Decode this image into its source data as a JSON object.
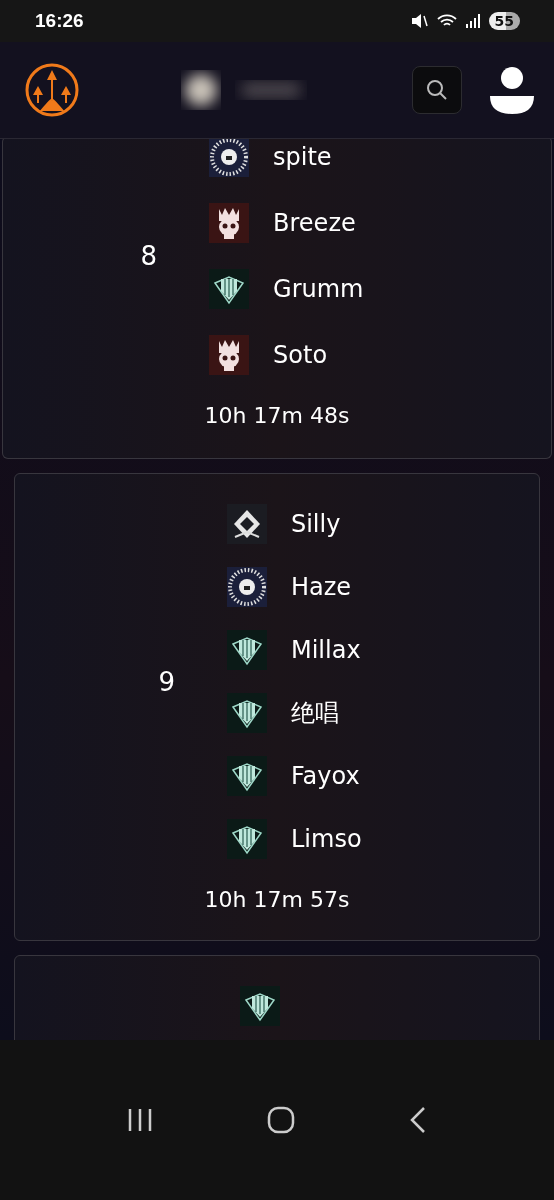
{
  "status_bar": {
    "time": "16:26",
    "battery": "55"
  },
  "groups": [
    {
      "rank": "8",
      "timer": "10h 17m 48s",
      "players": [
        {
          "name": "spite",
          "kind": "sunburst"
        },
        {
          "name": "Breeze",
          "kind": "crown-skull"
        },
        {
          "name": "Grumm",
          "kind": "shield"
        },
        {
          "name": "Soto",
          "kind": "crown-skull"
        }
      ]
    },
    {
      "rank": "9",
      "timer": "10h 17m 57s",
      "players": [
        {
          "name": "Silly",
          "kind": "diamond"
        },
        {
          "name": "Haze",
          "kind": "sunburst"
        },
        {
          "name": "Millax",
          "kind": "shield"
        },
        {
          "name": "绝唱",
          "kind": "shield"
        },
        {
          "name": "Fayox",
          "kind": "shield"
        },
        {
          "name": "Limso",
          "kind": "shield"
        }
      ]
    },
    {
      "players": [
        {
          "kind": "shield"
        }
      ]
    }
  ]
}
